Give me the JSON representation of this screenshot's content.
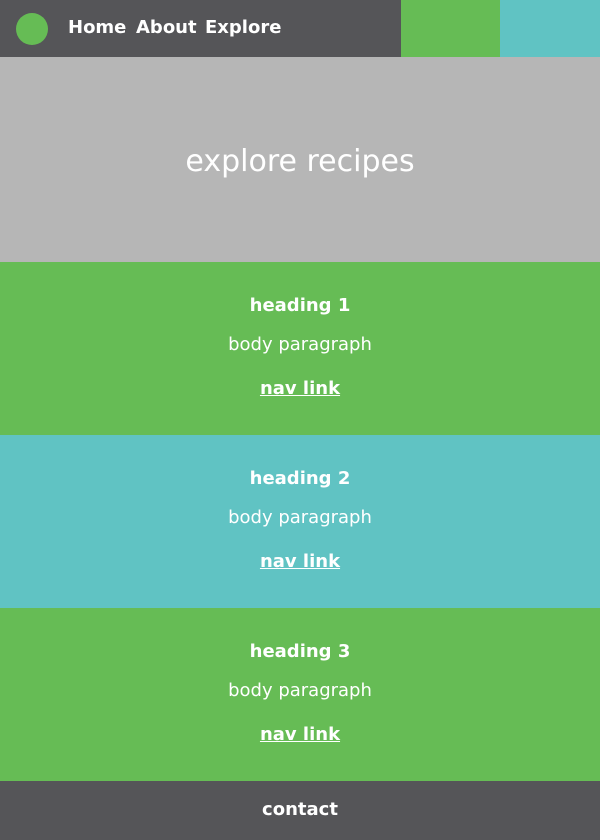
{
  "nav": {
    "home": "Home",
    "about": "About",
    "explore": "Explore"
  },
  "hero": {
    "title": "explore recipes"
  },
  "sections": [
    {
      "heading": "heading 1",
      "body": "body paragraph",
      "link": "nav link"
    },
    {
      "heading": "heading 2",
      "body": "body paragraph",
      "link": "nav link"
    },
    {
      "heading": "heading 3",
      "body": "body paragraph",
      "link": "nav link"
    }
  ],
  "footer": {
    "label": "contact"
  },
  "colors": {
    "dark": "#555558",
    "green": "#66bc55",
    "teal": "#60c3c3",
    "hero_gray": "#b6b6b6",
    "text": "#ffffff"
  }
}
